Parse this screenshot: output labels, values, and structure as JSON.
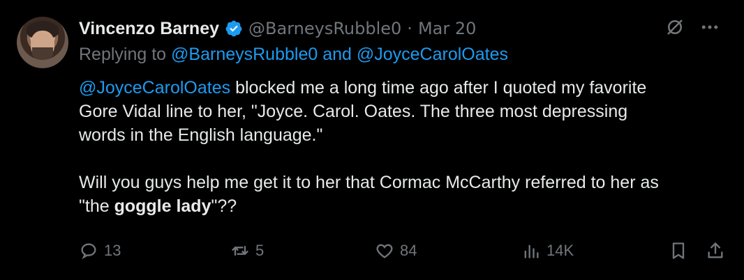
{
  "tweet": {
    "author_name": "Vincenzo Barney",
    "author_handle": "@BarneysRubble0",
    "separator": "·",
    "date": "Mar 20",
    "replying_prefix": "Replying to",
    "reply_handle_1": "@BarneysRubble0",
    "reply_and": "and",
    "reply_handle_2": "@JoyceCarolOates",
    "body_mention": "@JoyceCarolOates",
    "body_line1_rest": " blocked me a long time ago after I quoted my favorite",
    "body_line2": "Gore Vidal line to her, \"Joyce. Carol. Oates. The three most depressing",
    "body_line3": "words in the English language.\"",
    "body_line4": "Will you guys help me get it to her that Cormac McCarthy referred to her as",
    "body_line5_prefix": "\"the ",
    "body_line5_bold": "goggle lady",
    "body_line5_suffix": "\"??"
  },
  "actions": {
    "replies": "13",
    "reposts": "5",
    "likes": "84",
    "views": "14K"
  },
  "colors": {
    "background": "#000000",
    "text": "#e7e9ea",
    "muted": "#71767b",
    "link": "#1d9bf0",
    "verified": "#1d9bf0"
  },
  "icons": [
    "verified-badge-icon",
    "grok-icon",
    "more-icon",
    "reply-icon",
    "repost-icon",
    "like-icon",
    "views-icon",
    "bookmark-icon",
    "share-icon"
  ]
}
